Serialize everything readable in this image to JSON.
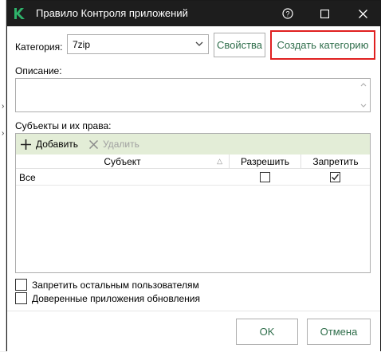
{
  "window": {
    "title": "Правило Контроля приложений",
    "help_glyph": "?",
    "maximize_glyph": "□",
    "close_glyph": "✕"
  },
  "category": {
    "label": "Категория:",
    "selected": "7zip",
    "properties_button": "Свойства",
    "create_button": "Создать категорию"
  },
  "description": {
    "label": "Описание:",
    "value": ""
  },
  "subjects": {
    "label": "Субъекты и их права:",
    "add_button": "Добавить",
    "remove_button": "Удалить",
    "columns": [
      "Субъект",
      "Разрешить",
      "Запретить"
    ],
    "rows": [
      {
        "subject": "Все",
        "allow": false,
        "deny": true
      }
    ]
  },
  "options": {
    "deny_others": "Запретить остальным пользователям",
    "trusted_updaters": "Доверенные приложения обновления"
  },
  "footer": {
    "ok": "OK",
    "cancel": "Отмена"
  },
  "colors": {
    "accent": "#2f6e4b",
    "highlight_border": "#e02020",
    "toolbar_bg": "#e3edd7",
    "titlebar_bg": "#1d1d1d"
  }
}
